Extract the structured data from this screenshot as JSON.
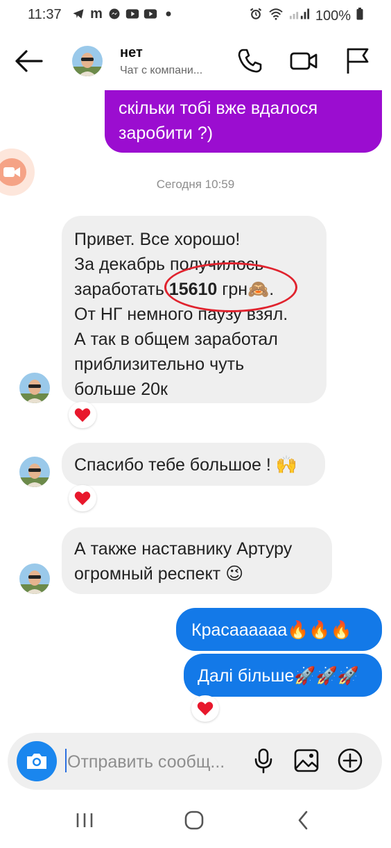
{
  "status_bar": {
    "time": "11:37",
    "apps": [
      "telegram-icon",
      "m",
      "messenger-icon",
      "youtube-icon",
      "youtube-icon",
      "dot"
    ],
    "battery": "100%"
  },
  "header": {
    "name": "нет",
    "subtitle": "Чат с компани..."
  },
  "messages": {
    "outgoing_1": "скільки тобі вже вдалося\nзаробити ?)",
    "timestamp": "Сегодня 10:59",
    "incoming_1_line1": "Привет. Все хорошо!",
    "incoming_1_line2": "За декабрь получилось",
    "incoming_1_line3a": "заработать ",
    "incoming_1_amount": "15610",
    "incoming_1_line3b": " грн🙈.",
    "incoming_1_line4": "От НГ немного паузу взял.",
    "incoming_1_line5": "А так в общем заработал",
    "incoming_1_line6": "приблизительно чуть",
    "incoming_1_line7": "больше 20к",
    "incoming_2": "Спасибо тебе большое ! 🙌",
    "incoming_3": "А также наставнику Артуру\nогромный респект 😉",
    "outgoing_2": "Красаааааа🔥🔥🔥",
    "outgoing_3": "Далі більше🚀🚀🚀",
    "reaction": "❤️"
  },
  "composer": {
    "placeholder": "Отправить сообщ..."
  },
  "colors": {
    "purple": "#9b0dd0",
    "blue": "#1379e8",
    "incoming": "#efefef",
    "highlight_red": "#e0232e"
  }
}
